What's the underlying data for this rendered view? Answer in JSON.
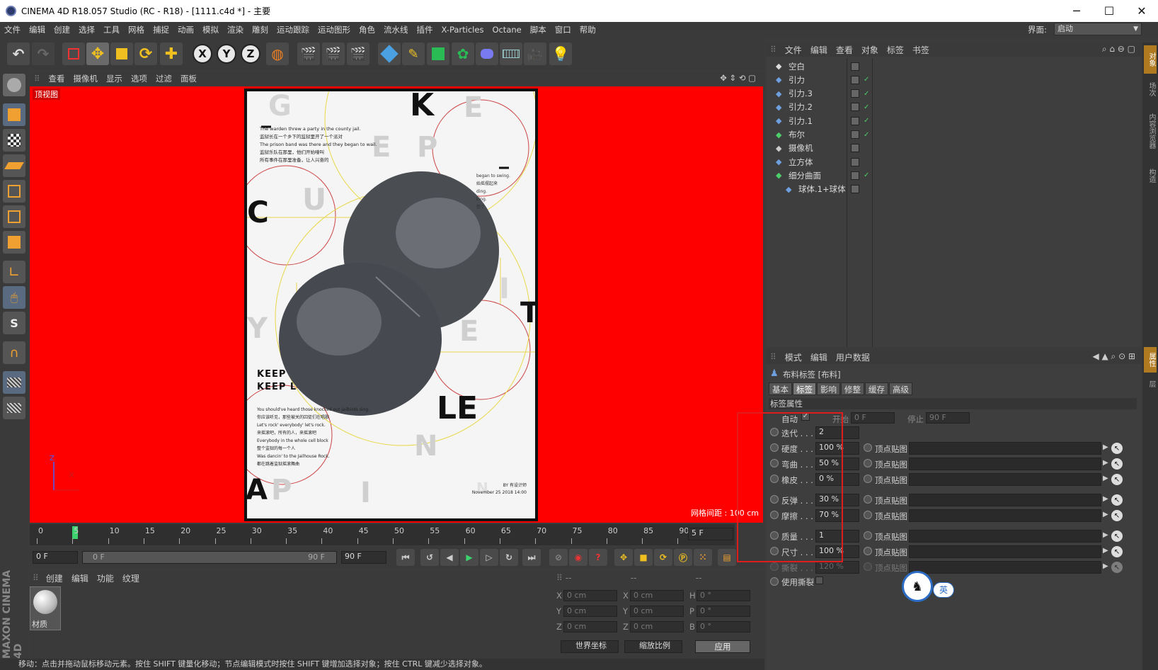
{
  "window": {
    "title": "CINEMA 4D R18.057 Studio (RC - R18) - [1111.c4d *] - 主要",
    "minimize": "─",
    "maximize": "☐",
    "close": "✕"
  },
  "menu": [
    "文件",
    "编辑",
    "创建",
    "选择",
    "工具",
    "网格",
    "捕捉",
    "动画",
    "模拟",
    "渲染",
    "雕刻",
    "运动跟踪",
    "运动图形",
    "角色",
    "流水线",
    "插件",
    "X-Particles",
    "Octane",
    "脚本",
    "窗口",
    "帮助"
  ],
  "layout": {
    "label": "界面:",
    "value": "启动"
  },
  "viewport": {
    "menu": [
      "查看",
      "摄像机",
      "显示",
      "选项",
      "过滤",
      "面板"
    ],
    "name": "顶视图",
    "grid_spacing": "网格间距 : 100 cm",
    "poster": {
      "lines1": [
        "The warden threw a party in the county jail.",
        "监狱长在一个乡下的监狱里开了一个派对",
        "The prison band was there and they began to wail.",
        "监狱乐队在那里，他们开始嚎叫",
        "所有事件在那里准备，让人兴奋的"
      ],
      "keep1": "KEEP",
      "keep2": "KEEP L",
      "lines2": [
        "You should've heard those knocked out jailbirds sing.",
        "你应该听见，那些被关的囚徒们在唱歌",
        "Let's rock' everybody' let's rock.",
        "来摇滚吧，所有的人，来摇滚吧",
        "Everybody in the whole cell block",
        "整个监狱的每一个人",
        "Was dancin' to the Jailhouse Rock.",
        "都在跳着监狱摇滚舞曲"
      ],
      "side_lines": [
        "began to swing.",
        "始摇摆起来",
        "ding.",
        "king.",
        "整个"
      ],
      "by": "BY 有设计师",
      "date": "November 25 2018 14:00",
      "letters": [
        "G",
        "K",
        "E",
        "E",
        "P",
        "C",
        "U",
        "I",
        "T",
        "E",
        "Y",
        "LE",
        "N",
        "A",
        "P",
        "I",
        "N"
      ]
    },
    "axis": {
      "z": "Z",
      "x": "X"
    }
  },
  "timeline": {
    "ticks": [
      "0",
      "5",
      "10",
      "15",
      "20",
      "25",
      "30",
      "35",
      "40",
      "45",
      "50",
      "55",
      "60",
      "65",
      "70",
      "75",
      "80",
      "85",
      "90"
    ],
    "current_frame": "5 F",
    "start": "0 F",
    "range_start": "0 F",
    "range_end": "90 F",
    "end": "90 F"
  },
  "material": {
    "menu": [
      "创建",
      "编辑",
      "功能",
      "纹理"
    ],
    "items": [
      {
        "name": "材质"
      }
    ]
  },
  "coords": {
    "headers": [
      "--",
      "--",
      "--"
    ],
    "rows": [
      {
        "a": "X",
        "av": "0 cm",
        "b": "X",
        "bv": "0 cm",
        "c": "H",
        "cv": "0 °"
      },
      {
        "a": "Y",
        "av": "0 cm",
        "b": "Y",
        "bv": "0 cm",
        "c": "P",
        "cv": "0 °"
      },
      {
        "a": "Z",
        "av": "0 cm",
        "b": "Z",
        "bv": "0 cm",
        "c": "B",
        "cv": "0 °"
      }
    ],
    "mode1": "世界坐标",
    "mode2": "缩放比例",
    "apply": "应用"
  },
  "status": "移动：点击并拖动鼠标移动元素。按住 SHIFT 键量化移动；节点编辑模式时按住 SHIFT 键增加选择对象；按住 CTRL 键减少选择对象。",
  "objects": {
    "menu": [
      "文件",
      "编辑",
      "查看",
      "对象",
      "标签",
      "书签"
    ],
    "rows": [
      {
        "name": "空白",
        "indent": 0
      },
      {
        "name": "引力",
        "indent": 0
      },
      {
        "name": "引力.3",
        "indent": 0
      },
      {
        "name": "引力.2",
        "indent": 0
      },
      {
        "name": "引力.1",
        "indent": 0
      },
      {
        "name": "布尔",
        "indent": 0
      },
      {
        "name": "摄像机",
        "indent": 0
      },
      {
        "name": "立方体",
        "indent": 0
      },
      {
        "name": "细分曲面",
        "indent": 0
      },
      {
        "name": "球体.1+球体",
        "indent": 1
      }
    ]
  },
  "attributes": {
    "menu": [
      "模式",
      "编辑",
      "用户数据"
    ],
    "title": "布料标签 [布料]",
    "tabs": [
      "基本",
      "标签",
      "影响",
      "修整",
      "缓存",
      "高级"
    ],
    "active_tab": "标签",
    "section": "标签属性",
    "auto_label": "自动",
    "start_label": "开始",
    "start_value": "0 F",
    "stop_label": "停止",
    "stop_value": "90 F",
    "fields": [
      {
        "label": "迭代 . . .",
        "value": "2",
        "vmap": ""
      },
      {
        "label": "硬度 . . .",
        "value": "100 %",
        "vmap": "顶点贴图"
      },
      {
        "label": "弯曲 . . .",
        "value": "50 %",
        "vmap": "顶点贴图"
      },
      {
        "label": "橡皮 . . .",
        "value": "0 %",
        "vmap": "顶点贴图"
      },
      {
        "label": "反弹 . . .",
        "value": "30 %",
        "vmap": "顶点贴图"
      },
      {
        "label": "摩擦 . . .",
        "value": "70 %",
        "vmap": "顶点贴图"
      },
      {
        "label": "质量 . . .",
        "value": "1",
        "vmap": "顶点贴图"
      },
      {
        "label": "尺寸 . . .",
        "value": "100 %",
        "vmap": "顶点贴图"
      },
      {
        "label": "撕裂 . . .",
        "value": "120 %",
        "vmap": "顶点贴图"
      }
    ],
    "use_tear": "使用撕裂"
  },
  "right_tabs": [
    "对象",
    "场次",
    "内容浏览器",
    "构造",
    "属性",
    "层"
  ],
  "ime": {
    "label": "英"
  },
  "colors": {
    "highlight_box": "#e01c1c",
    "viewport": "#ff0000",
    "accent": "#5a9bd4"
  }
}
